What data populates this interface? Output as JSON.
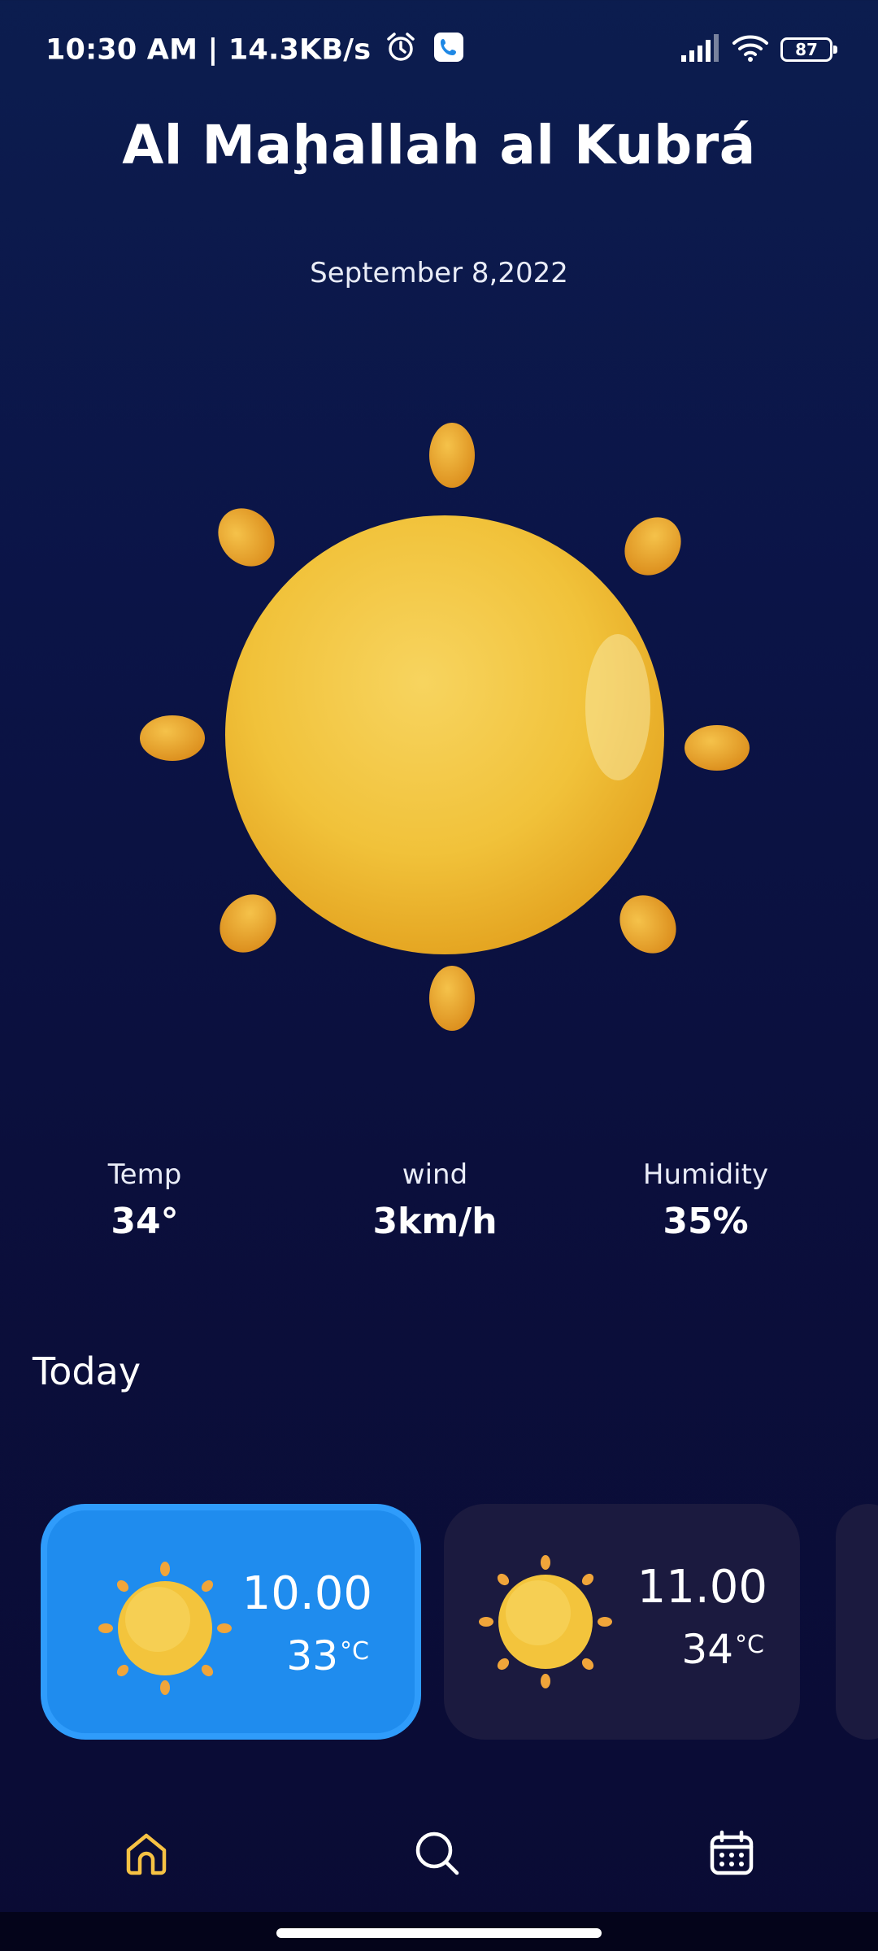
{
  "status_bar": {
    "time_text": "10:30 AM | 14.3KB/s",
    "battery": "87",
    "icons": [
      "alarm-icon",
      "phone-call-icon",
      "signal-icon",
      "wifi-icon",
      "battery-icon"
    ]
  },
  "location": {
    "city": "Al Maḩallah al Kubrá",
    "date": "September 8,2022"
  },
  "current": {
    "weather_icon": "sun-icon"
  },
  "stats": [
    {
      "label": "Temp",
      "value": "34°"
    },
    {
      "label": "wind",
      "value": "3km/h"
    },
    {
      "label": "Humidity",
      "value": "35%"
    }
  ],
  "today_label": "Today",
  "hourly": [
    {
      "time": "10.00",
      "temp": "33",
      "unit": "°C",
      "icon": "sun-icon",
      "selected": true
    },
    {
      "time": "11.00",
      "temp": "34",
      "unit": "°C",
      "icon": "sun-icon",
      "selected": false
    }
  ],
  "nav": [
    {
      "name": "home-icon",
      "active": true
    },
    {
      "name": "search-icon",
      "active": false
    },
    {
      "name": "calendar-icon",
      "active": false
    }
  ],
  "colors": {
    "accent": "#f6c244",
    "selected_card": "#1f8cee",
    "card": "#1b1a3f"
  }
}
